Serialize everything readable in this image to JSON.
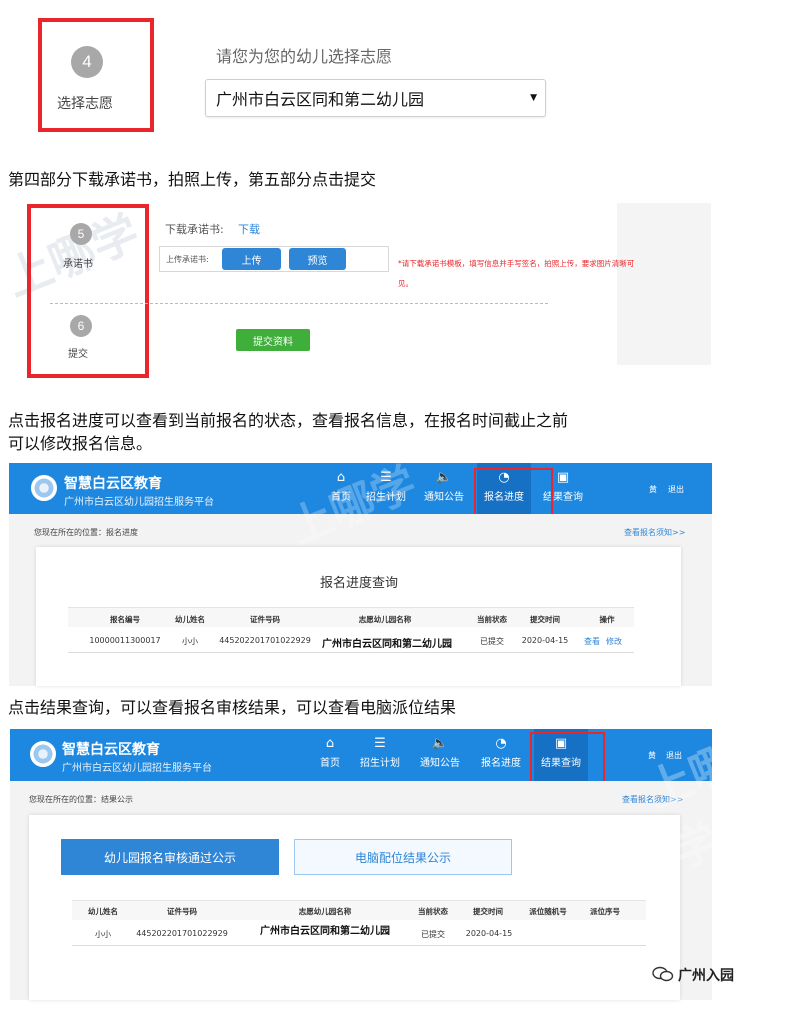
{
  "step4": {
    "number": "4",
    "label": "选择志愿",
    "prompt": "请您为您的幼儿选择志愿",
    "selected_school": "广州市白云区同和第二幼儿园"
  },
  "caption1": "第四部分下载承诺书，拍照上传，第五部分点击提交",
  "step5": {
    "number": "5",
    "label": "承诺书",
    "download_label": "下载承诺书:",
    "download_link": "下载",
    "upload_label": "上传承诺书:",
    "upload_button": "上传",
    "preview_button": "预览",
    "note_line1": "*请下载承诺书模板，填写信息并手写签名，拍照上传，要求图片清晰可",
    "note_line2": "见。"
  },
  "step6": {
    "number": "6",
    "label": "提交",
    "submit_button": "提交资料"
  },
  "caption2_line1": "点击报名进度可以查看到当前报名的状态，查看报名信息，在报名时间截止之前",
  "caption2_line2": "可以修改报名信息。",
  "site": {
    "title": "智慧白云区教育",
    "subtitle": "广州市白云区幼儿园招生服务平台",
    "nav": [
      "首页",
      "招生计划",
      "通知公告",
      "报名进度",
      "结果查询"
    ],
    "user": "黄",
    "logout": "退出"
  },
  "progress_page": {
    "breadcrumb": "您现在所在的位置：报名进度",
    "top_link": "查看报名须知>>",
    "heading": "报名进度查询",
    "headers": [
      "报名编号",
      "幼儿姓名",
      "证件号码",
      "志愿幼儿园名称",
      "当前状态",
      "提交时间",
      "操作"
    ],
    "row": {
      "id": "10000011300017",
      "name": "小小",
      "cert": "445202201701022929",
      "school": "广州市白云区同和第二幼儿园",
      "status": "已提交",
      "time": "2020-04-15",
      "view": "查看",
      "edit": "修改"
    }
  },
  "caption3": "点击结果查询，可以查看报名审核结果，可以查看电脑派位结果",
  "result_page": {
    "breadcrumb": "您现在所在的位置：结果公示",
    "top_link": "查看报名须知>>",
    "tab_audit": "幼儿园报名审核通过公示",
    "tab_lottery": "电脑配位结果公示",
    "headers": [
      "幼儿姓名",
      "证件号码",
      "志愿幼儿园名称",
      "当前状态",
      "提交时间",
      "派位随机号",
      "派位序号"
    ],
    "row": {
      "name": "小小",
      "cert": "445202201701022929",
      "school": "广州市白云区同和第二幼儿园",
      "status": "已提交",
      "time": "2020-04-15"
    }
  },
  "watermark_text": "上哪学",
  "footer_brand": "广州入园"
}
